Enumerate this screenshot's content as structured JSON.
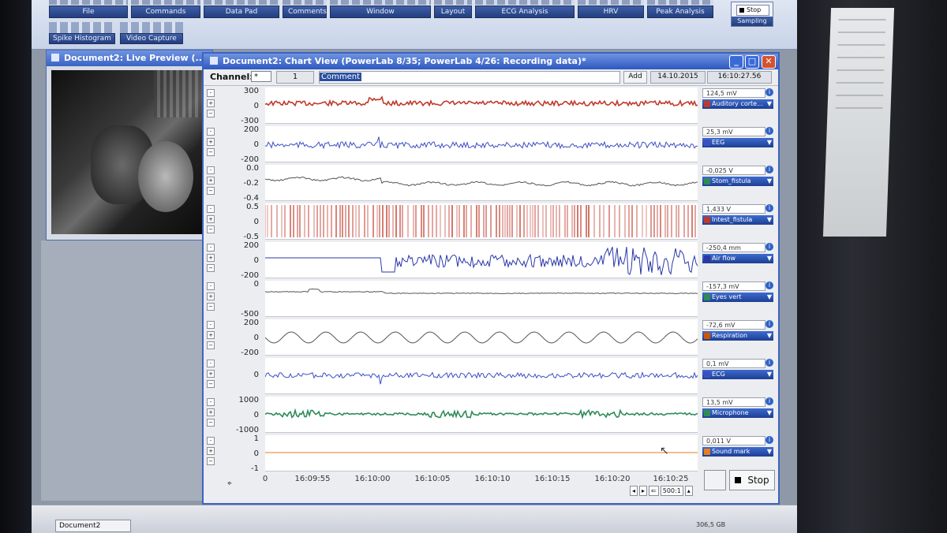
{
  "ribbon": {
    "groups": [
      "File",
      "Commands",
      "Data Pad",
      "Comments",
      "Window",
      "Layout",
      "ECG Analysis",
      "HRV",
      "Peak Analysis"
    ],
    "row2": [
      "Spike Histogram",
      "Video Capture"
    ],
    "sampling": {
      "label": "Sampling",
      "button": "Stop"
    }
  },
  "live_preview": {
    "title": "Document2: Live Preview (..."
  },
  "chart_view": {
    "title": "Document2: Chart View (PowerLab 8/35; PowerLab 4/26: Recording data)*",
    "toolbar": {
      "channel_label": "Channel:",
      "channel_value": "*",
      "number_value": "1",
      "comment_value": "Comment",
      "add_label": "Add",
      "date": "14.10.2015",
      "time": "16:10:27.56"
    },
    "channels": [
      {
        "name": "Auditory corte...",
        "value": "124,5 mV",
        "color": "#c0392b",
        "ticks": [
          "300",
          "0",
          "-300"
        ]
      },
      {
        "name": "EEG",
        "value": "25,3 mV",
        "color": "#3b4fc4",
        "ticks": [
          "200",
          "0",
          "-200"
        ]
      },
      {
        "name": "Stom_fistula",
        "value": "-0,025 V",
        "color": "#2e8b57",
        "ticks": [
          "0.0",
          "-0.2",
          "-0.4"
        ]
      },
      {
        "name": "Intest_fistula",
        "value": "1,433 V",
        "color": "#c0392b",
        "ticks": [
          "0.5",
          "0",
          "-0.5"
        ]
      },
      {
        "name": "Air flow",
        "value": "-250,4 mm",
        "color": "#2a37a8",
        "ticks": [
          "200",
          "0",
          "-200"
        ]
      },
      {
        "name": "Eyes vert",
        "value": "-157,3 mV",
        "color": "#2e8b57",
        "ticks": [
          "0",
          "-500"
        ]
      },
      {
        "name": "Respiration",
        "value": "-72,6 mV",
        "color": "#d35400",
        "ticks": [
          "200",
          "0",
          "-200"
        ]
      },
      {
        "name": "ECG",
        "value": "0,1 mV",
        "color": "#3b4fc4",
        "ticks": [
          "0"
        ]
      },
      {
        "name": "Microphone",
        "value": "13,5 mV",
        "color": "#2e8b57",
        "ticks": [
          "1000",
          "0",
          "-1000"
        ]
      },
      {
        "name": "Sound mark",
        "value": "0,011 V",
        "color": "#e67e22",
        "ticks": [
          "1",
          "0",
          "-1"
        ]
      }
    ],
    "time_axis": [
      "0",
      "16:09:55",
      "16:10:00",
      "16:10:05",
      "16:10:10",
      "16:10:15",
      "16:10:20",
      "16:10:25"
    ],
    "zoom": "500:1",
    "stop_label": "Stop"
  },
  "taskbar": {
    "doc_label": "Document2",
    "status": "306,5 GB"
  }
}
